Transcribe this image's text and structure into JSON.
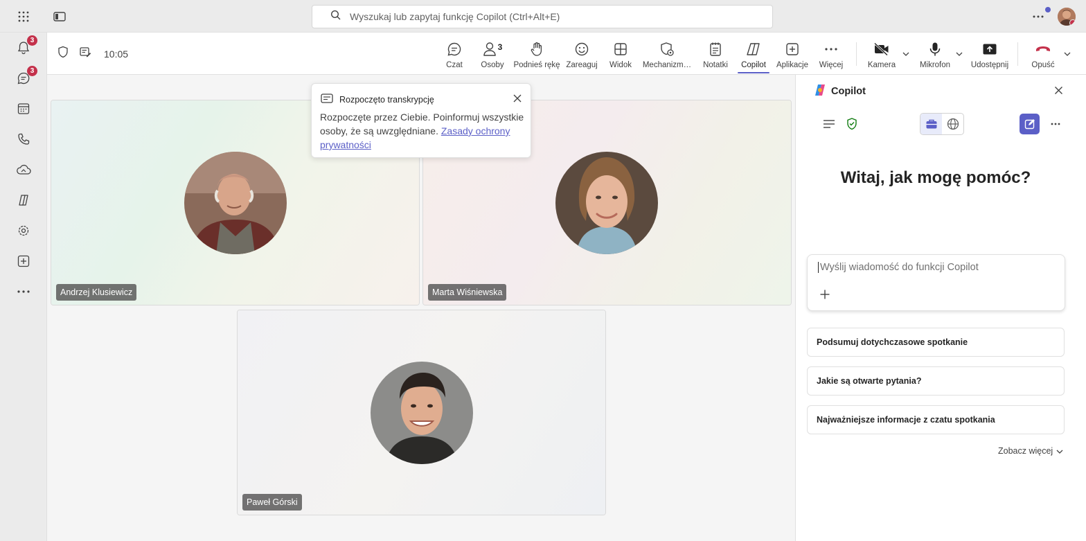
{
  "topbar": {
    "search_placeholder": "Wyszukaj lub zapytaj funkcję Copilot (Ctrl+Alt+E)",
    "icons": [
      "apps-grid-icon",
      "sidebar-toggle-icon",
      "search-icon",
      "more-icon"
    ]
  },
  "rail": {
    "items": [
      {
        "icon": "bell-icon",
        "badge": "3"
      },
      {
        "icon": "chat-icon",
        "badge": "3"
      },
      {
        "icon": "calendar-icon",
        "badge": ""
      },
      {
        "icon": "phone-icon",
        "badge": ""
      },
      {
        "icon": "cloud-icon",
        "badge": ""
      },
      {
        "icon": "copilot-icon",
        "badge": ""
      },
      {
        "icon": "settings-apps-icon",
        "badge": ""
      },
      {
        "icon": "add-app-icon",
        "badge": ""
      },
      {
        "icon": "more-icon",
        "badge": ""
      }
    ]
  },
  "toolbar": {
    "time": "10:05",
    "chat": "Czat",
    "people": "Osoby",
    "people_count": "3",
    "raise_hand": "Podnieś rękę",
    "react": "Zareaguj",
    "view": "Widok",
    "mechanisms": "Mechanizm…",
    "notes": "Notatki",
    "copilot": "Copilot",
    "apps": "Aplikacje",
    "more": "Więcej",
    "camera": "Kamera",
    "mic": "Mikrofon",
    "share": "Udostępnij",
    "leave": "Opuść"
  },
  "participants": [
    {
      "name": "Andrzej Klusiewicz"
    },
    {
      "name": "Marta Wiśniewska"
    },
    {
      "name": "Paweł Górski"
    }
  ],
  "toast": {
    "title": "Rozpoczęto transkrypcję",
    "body": "Rozpoczęte przez Ciebie. Poinformuj wszystkie osoby, że są uwzględniane.",
    "link": "Zasady ochrony prywatności"
  },
  "copilot": {
    "title": "Copilot",
    "heading": "Witaj, jak mogę pomóc?",
    "input_placeholder": "Wyślij wiadomość do funkcji Copilot",
    "prompts": [
      "Podsumuj dotychczasowe spotkanie",
      "Jakie są otwarte pytania?",
      "Najważniejsze informacje z czatu spotkania"
    ],
    "see_more": "Zobacz więcej"
  },
  "colors": {
    "accent": "#5b5fc7",
    "badge": "#c4314b",
    "leave": "#c4314b",
    "shield_ok": "#107c10"
  }
}
